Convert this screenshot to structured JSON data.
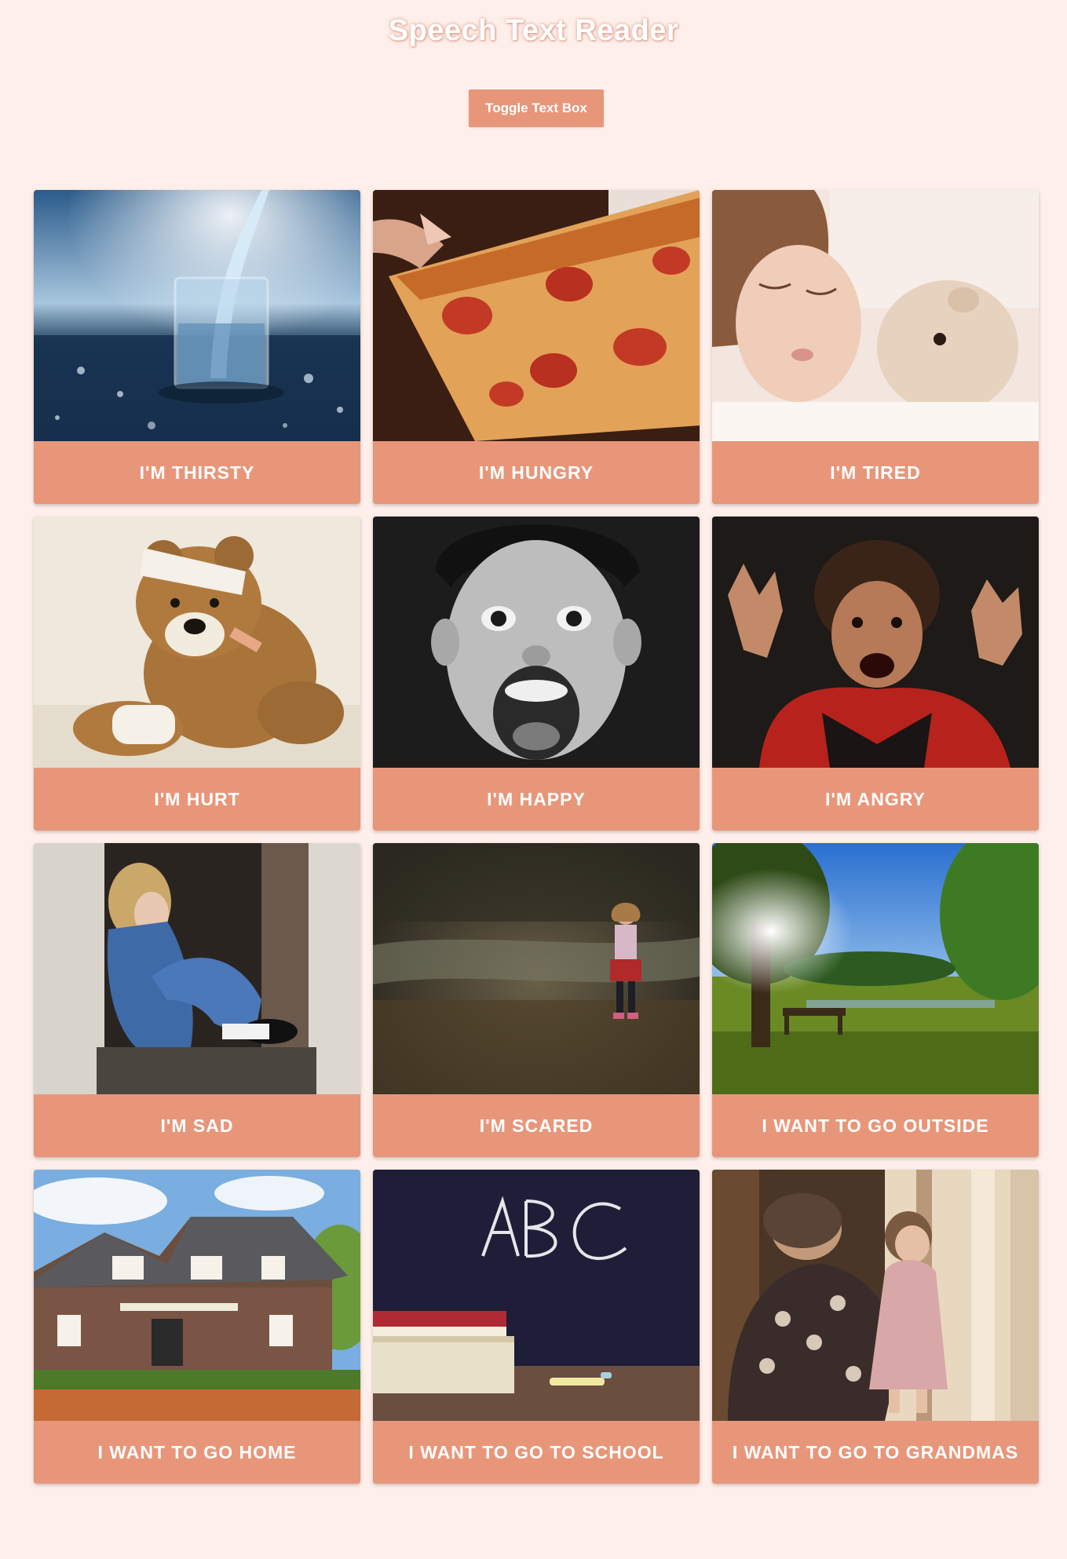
{
  "header": {
    "title": "Speech Text Reader",
    "toggle_label": "Toggle Text Box"
  },
  "colors": {
    "background": "#ffefea",
    "accent": "#e8967a",
    "label_text": "#ffffff"
  },
  "cards": [
    {
      "label": "I'm Thirsty",
      "image": "glass-of-water"
    },
    {
      "label": "I'm Hungry",
      "image": "pizza-slice"
    },
    {
      "label": "I'm Tired",
      "image": "sleeping-child"
    },
    {
      "label": "I'm Hurt",
      "image": "bandaged-teddy-bear"
    },
    {
      "label": "I'm Happy",
      "image": "excited-boy"
    },
    {
      "label": "I'm Angry",
      "image": "angry-boy"
    },
    {
      "label": "I'm Sad",
      "image": "sad-child-in-doorway"
    },
    {
      "label": "I'm Scared",
      "image": "scared-girl-in-forest"
    },
    {
      "label": "I Want To Go Outside",
      "image": "sunny-park"
    },
    {
      "label": "I Want To Go Home",
      "image": "brick-house"
    },
    {
      "label": "I Want To Go To School",
      "image": "chalkboard-abc"
    },
    {
      "label": "I Want To Go To Grandmas",
      "image": "grandma-and-child"
    }
  ]
}
